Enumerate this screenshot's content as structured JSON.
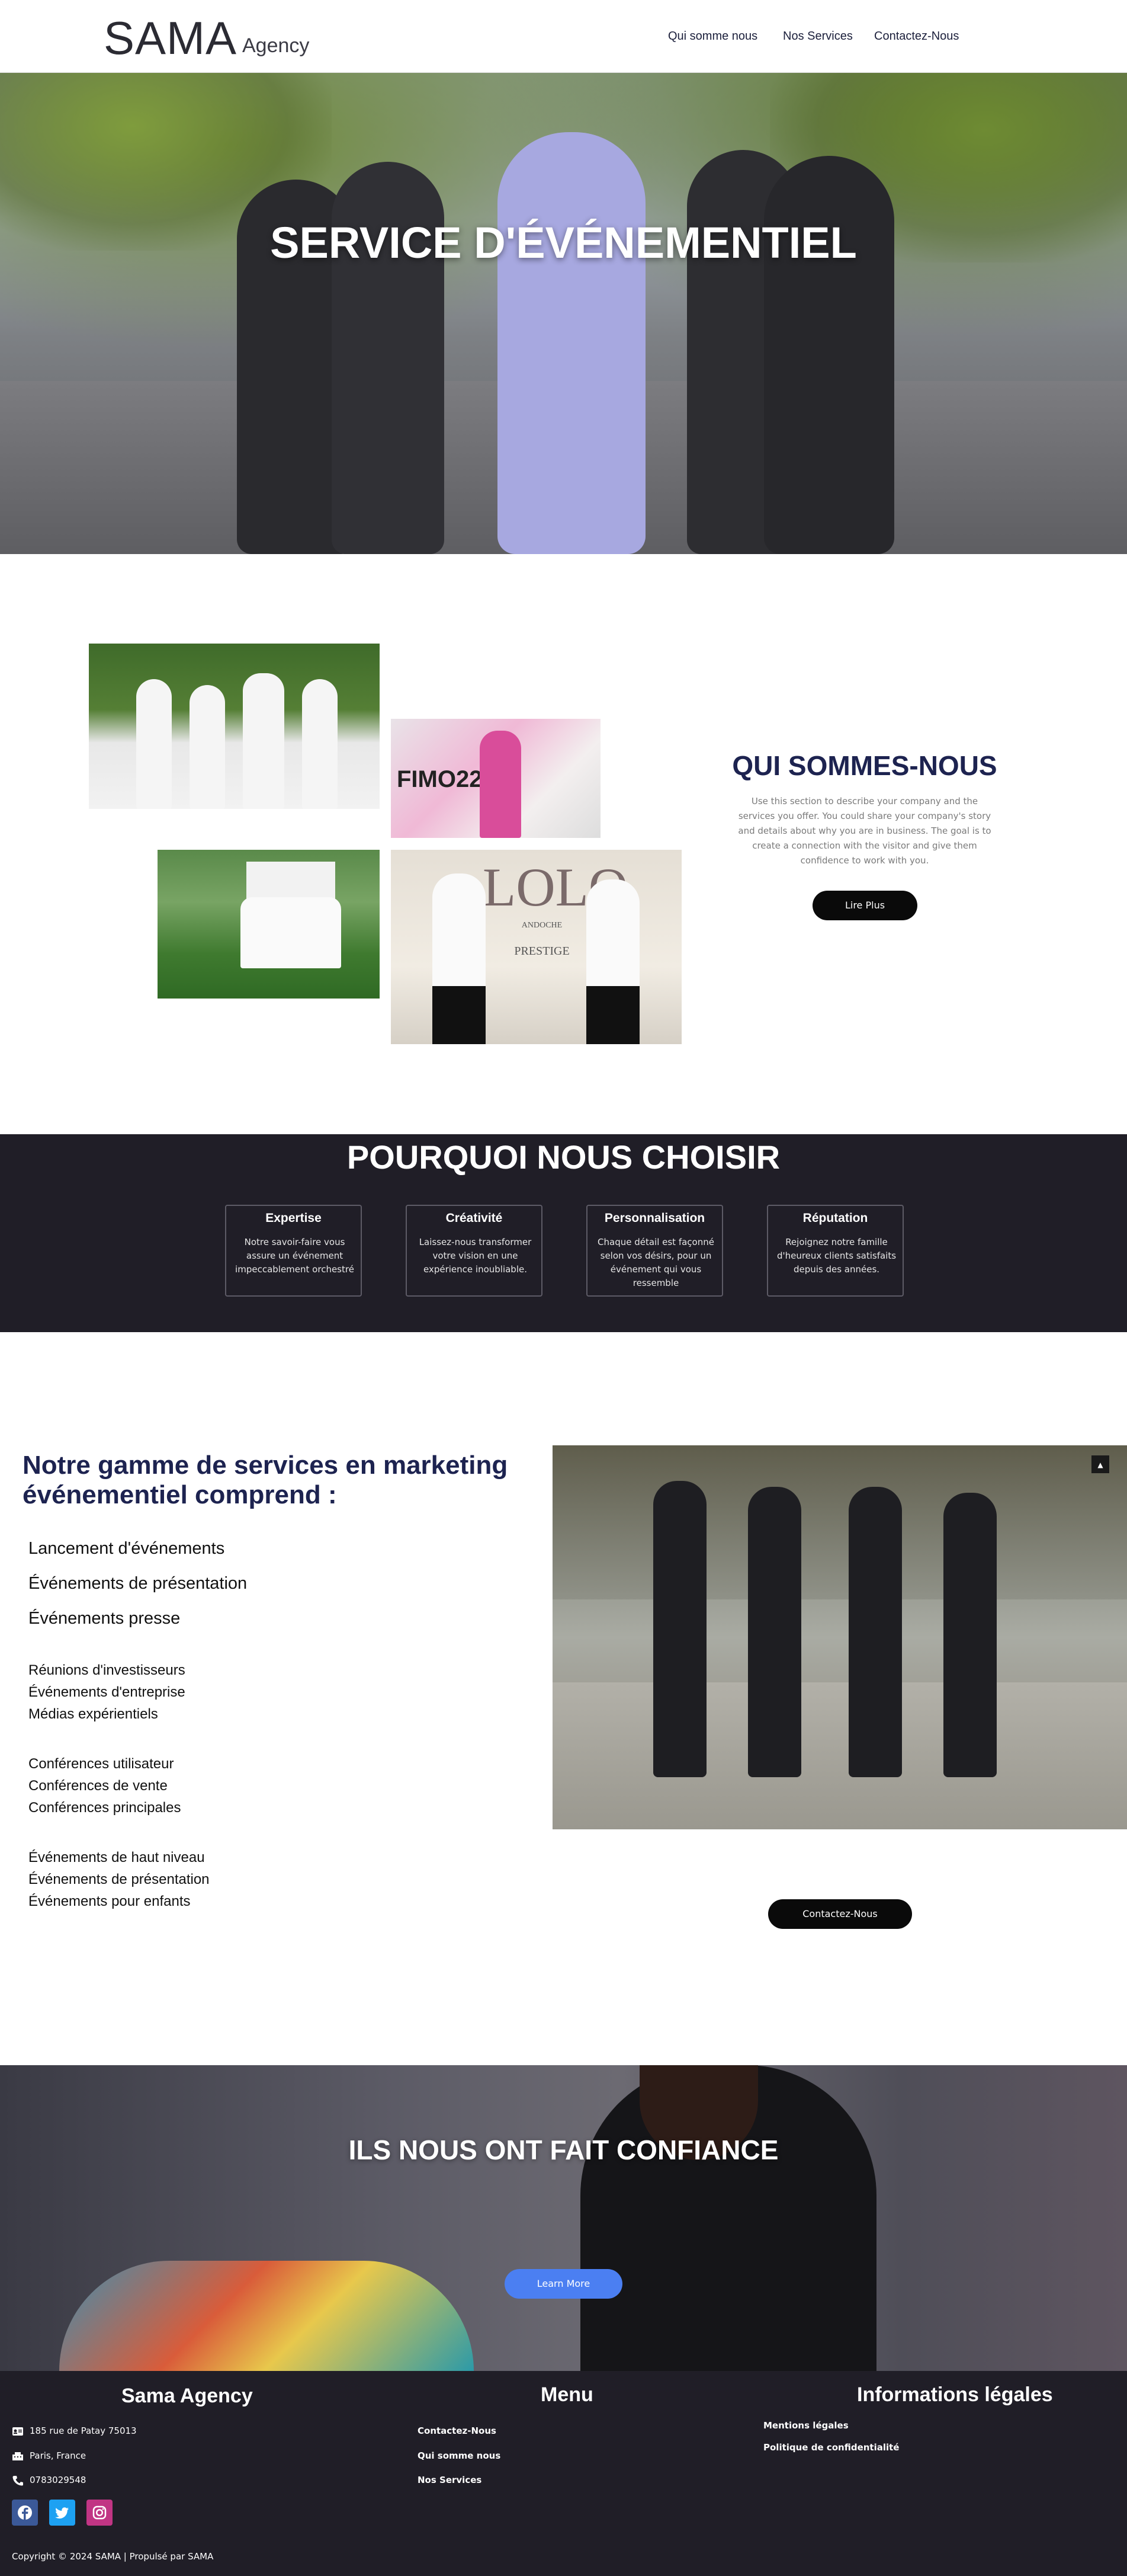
{
  "header": {
    "logo_main": "SAMA",
    "logo_sub": "Agency",
    "nav": [
      "Qui somme nous",
      "Nos Services",
      "Contactez-Nous"
    ]
  },
  "hero": {
    "title": "SERVICE D'ÉVÉNEMENTIEL"
  },
  "about": {
    "title": "QUI SOMMES-NOUS",
    "text": "Use this section to describe your company and the services you offer. You could share your company's story and details about why you are in business. The goal is to create a connection with the visitor and give them confidence to work with you.",
    "button": "Lire Plus",
    "photo2_sign": "FIMO228",
    "photo4_sign": "LOLO",
    "photo4_sub1": "ANDOCHE",
    "photo4_sub2": "PRESTIGE"
  },
  "why": {
    "title": "POURQUOI NOUS CHOISIR",
    "cards": [
      {
        "title": "Expertise",
        "text": "Notre savoir-faire vous assure un événement impeccablement orchestré"
      },
      {
        "title": "Créativité",
        "text": "Laissez-nous transformer votre vision en une expérience inoubliable."
      },
      {
        "title": "Personnalisation",
        "text": "Chaque détail est façonné selon vos désirs, pour un événement qui vous ressemble"
      },
      {
        "title": "Réputation",
        "text": "Rejoignez notre famille d'heureux clients satisfaits depuis des années."
      }
    ]
  },
  "services": {
    "title": "Notre gamme de services en marketing événementiel comprend :",
    "group1": [
      "Lancement d'événements",
      "Événements de présentation",
      "Événements presse"
    ],
    "group2": [
      "Réunions d'investisseurs",
      "Événements d'entreprise",
      "Médias expérientiels"
    ],
    "group3": [
      "Conférences utilisateur",
      "Conférences de vente",
      "Conférences principales"
    ],
    "group4": [
      "Événements de haut niveau",
      "Événements de présentation",
      "Événements pour enfants"
    ],
    "button": "Contactez-Nous",
    "scroll_top": "▲"
  },
  "trust": {
    "title": "ILS NOUS ONT FAIT CONFIANCE",
    "button": "Learn More"
  },
  "footer": {
    "brand": "Sama Agency",
    "address": "185 rue de Patay 75013",
    "city": "Paris, France",
    "phone": "0783029548",
    "menu_title": "Menu",
    "menu": [
      "Contactez-Nous",
      "Qui somme nous",
      "Nos Services"
    ],
    "legal_title": "Informations légales",
    "legal": [
      "Mentions légales",
      "Politique de confidentialité"
    ],
    "copyright": "Copyright © 2024 SAMA | Propulsé par SAMA"
  },
  "colors": {
    "navy": "#1d2350",
    "dark": "#201e27",
    "blue_button": "#4b7ff2",
    "facebook": "#3b5998",
    "twitter": "#1da1f2",
    "instagram": "#c13584"
  }
}
